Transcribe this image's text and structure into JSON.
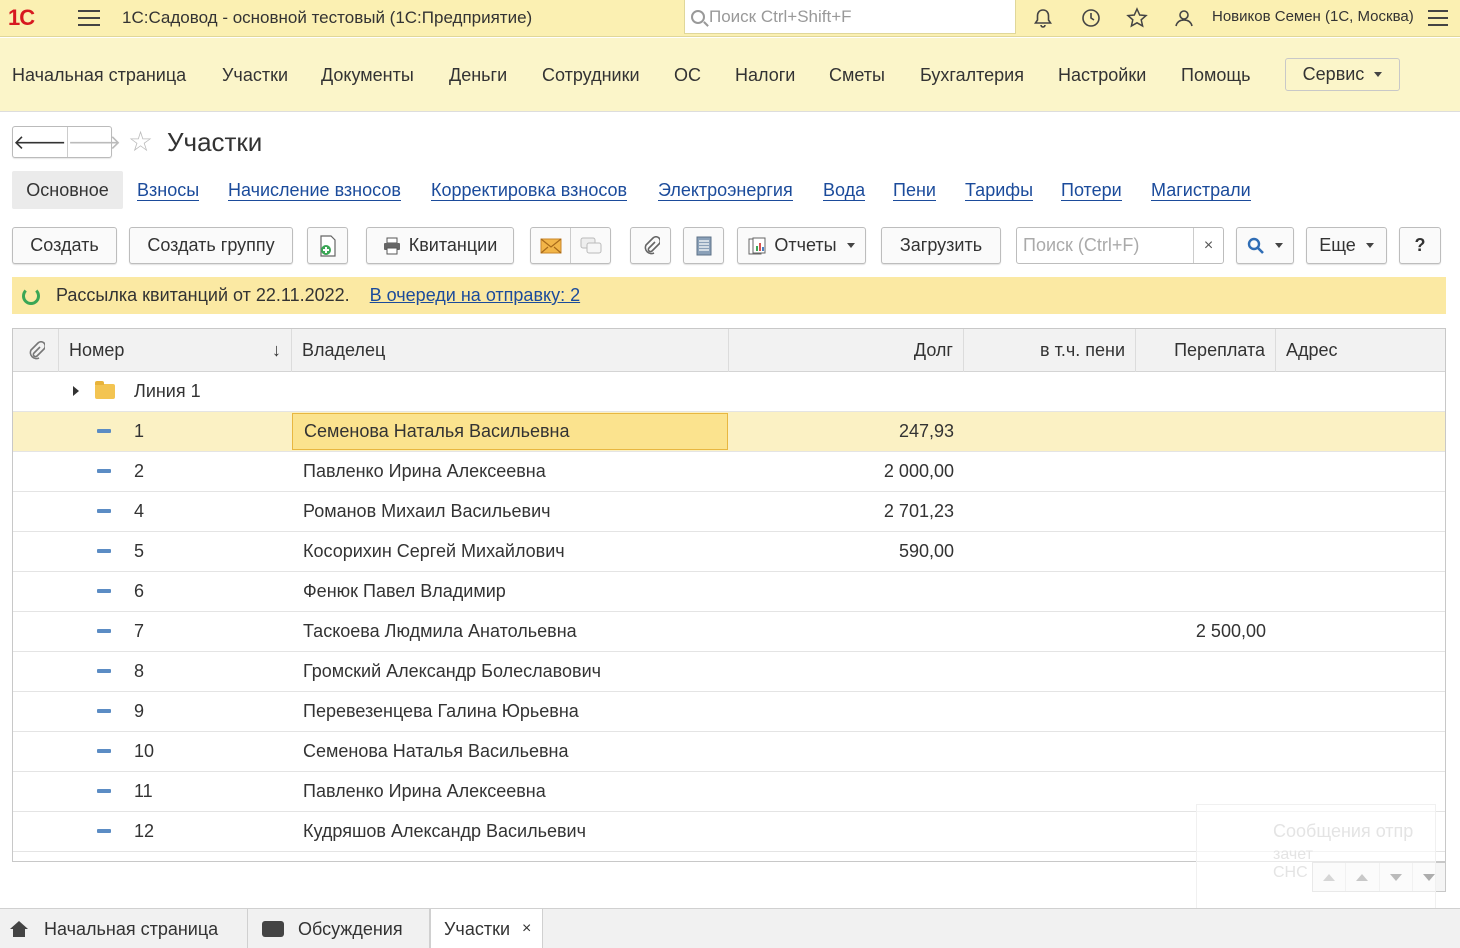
{
  "titlebar": {
    "logo": "1С",
    "title": "1С:Садовод - основной тестовый  (1С:Предприятие)",
    "search_placeholder": "Поиск Ctrl+Shift+F",
    "user": "Новиков Семен (1С, Москва)"
  },
  "sections": [
    "Начальная страница",
    "Участки",
    "Документы",
    "Деньги",
    "Сотрудники",
    "ОС",
    "Налоги",
    "Сметы",
    "Бухгалтерия",
    "Настройки",
    "Помощь"
  ],
  "servis_label": "Сервис",
  "form": {
    "title": "Участки",
    "tab_main": "Основное",
    "tabs": [
      "Взносы",
      "Начисление взносов",
      "Корректировка взносов",
      "Электроэнергия",
      "Вода",
      "Пени",
      "Тарифы",
      "Потери",
      "Магистрали"
    ]
  },
  "toolbar": {
    "create": "Создать",
    "create_group": "Создать группу",
    "receipts": "Квитанции",
    "reports": "Отчеты",
    "load": "Загрузить",
    "search_placeholder": "Поиск (Ctrl+F)",
    "clear": "×",
    "more": "Еще",
    "help": "?"
  },
  "info": {
    "text": "Рассылка квитанций от 22.11.2022.",
    "link": "В очереди на отправку: 2"
  },
  "table": {
    "columns": {
      "number": "Номер",
      "owner": "Владелец",
      "debt": "Долг",
      "penalty": "в т.ч. пени",
      "overpay": "Переплата",
      "address": "Адрес"
    },
    "group": "Линия 1",
    "rows": [
      {
        "number": "1",
        "owner": "Семенова Наталья Васильевна",
        "debt": "247,93",
        "overpay": ""
      },
      {
        "number": "2",
        "owner": "Павленко Ирина Алексеевна",
        "debt": "2 000,00",
        "overpay": ""
      },
      {
        "number": "4",
        "owner": "Романов Михаил Васильевич",
        "debt": "2 701,23",
        "overpay": ""
      },
      {
        "number": "5",
        "owner": "Косорихин Сергей Михайлович",
        "debt": "590,00",
        "overpay": ""
      },
      {
        "number": "6",
        "owner": "Фенюк Павел Владимир",
        "debt": "",
        "overpay": ""
      },
      {
        "number": "7",
        "owner": "Таскоева Людмила Анатольевна",
        "debt": "",
        "overpay": "2 500,00"
      },
      {
        "number": "8",
        "owner": "Громский Александр Болеславович",
        "debt": "",
        "overpay": ""
      },
      {
        "number": "9",
        "owner": "Перевезенцева Галина Юрьевна",
        "debt": "",
        "overpay": ""
      },
      {
        "number": "10",
        "owner": "Семенова Наталья Васильевна",
        "debt": "",
        "overpay": ""
      },
      {
        "number": "11",
        "owner": "Павленко Ирина Алексеевна",
        "debt": "",
        "overpay": ""
      },
      {
        "number": "12",
        "owner": "Кудряшов Александр Васильевич",
        "debt": "",
        "overpay": ""
      }
    ]
  },
  "ghost_notification": {
    "line1": "Сообщения отпр",
    "line2": "зачет",
    "line3": "СНС"
  },
  "bottom_tabs": [
    "Начальная страница",
    "Обсуждения",
    "Участки"
  ],
  "close_glyph": "×"
}
